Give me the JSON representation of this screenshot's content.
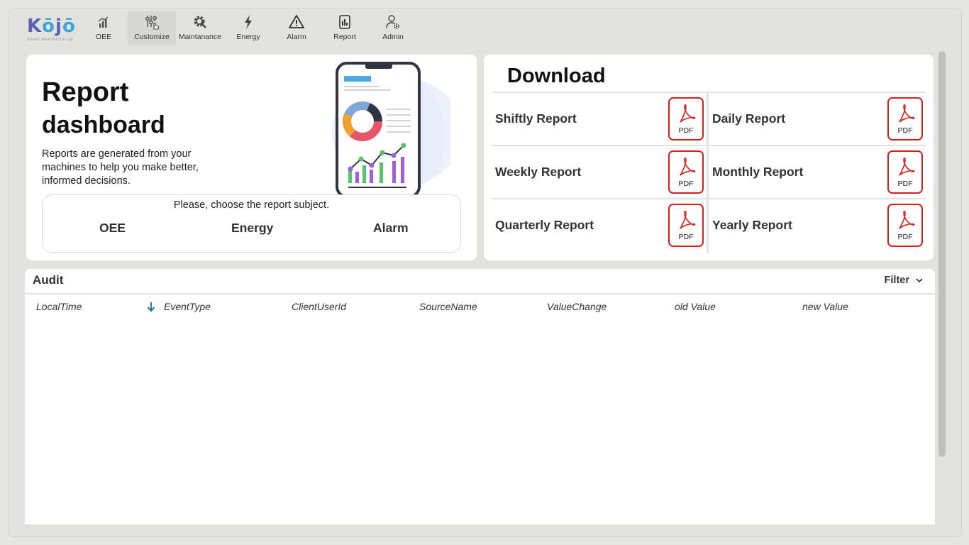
{
  "brand": {
    "name": "Kojo",
    "tagline": "Smart Manufacturing"
  },
  "nav": {
    "items": [
      {
        "label": "OEE",
        "icon": "bar-chart-icon"
      },
      {
        "label": "Customize",
        "icon": "sliders-hand-icon"
      },
      {
        "label": "Maintanance",
        "icon": "gear-wrench-icon"
      },
      {
        "label": "Energy",
        "icon": "lightning-icon"
      },
      {
        "label": "Alarm",
        "icon": "warning-triangle-icon"
      },
      {
        "label": "Report",
        "icon": "report-document-icon"
      },
      {
        "label": "Admin",
        "icon": "user-gear-icon"
      }
    ],
    "active": "Customize"
  },
  "report": {
    "title": "Report",
    "subtitle": "dashboard",
    "description": "Reports are generated from your machines to help you make better, informed decisions.",
    "subject_prompt": "Please, choose the report subject.",
    "subjects": [
      "OEE",
      "Energy",
      "Alarm"
    ]
  },
  "download": {
    "title": "Download",
    "reports": [
      {
        "label": "Shiftly Report",
        "file_type": "PDF"
      },
      {
        "label": "Daily Report",
        "file_type": "PDF"
      },
      {
        "label": "Weekly Report",
        "file_type": "PDF"
      },
      {
        "label": "Monthly Report",
        "file_type": "PDF"
      },
      {
        "label": "Quarterly Report",
        "file_type": "PDF"
      },
      {
        "label": "Yearly Report",
        "file_type": "PDF"
      }
    ]
  },
  "audit": {
    "title": "Audit",
    "filter_label": "Filter",
    "columns": [
      "LocalTime",
      "EventType",
      "ClientUserId",
      "SourceName",
      "ValueChange",
      "old Value",
      "new Value"
    ],
    "sorted_column": "EventType",
    "rows": []
  },
  "colors": {
    "brand_purple": "#5b61b5",
    "brand_blue": "#3aa6d8",
    "pdf_red": "#d61f1f",
    "sort_arrow": "#0a6e9e",
    "background": "#e6e7e3"
  }
}
